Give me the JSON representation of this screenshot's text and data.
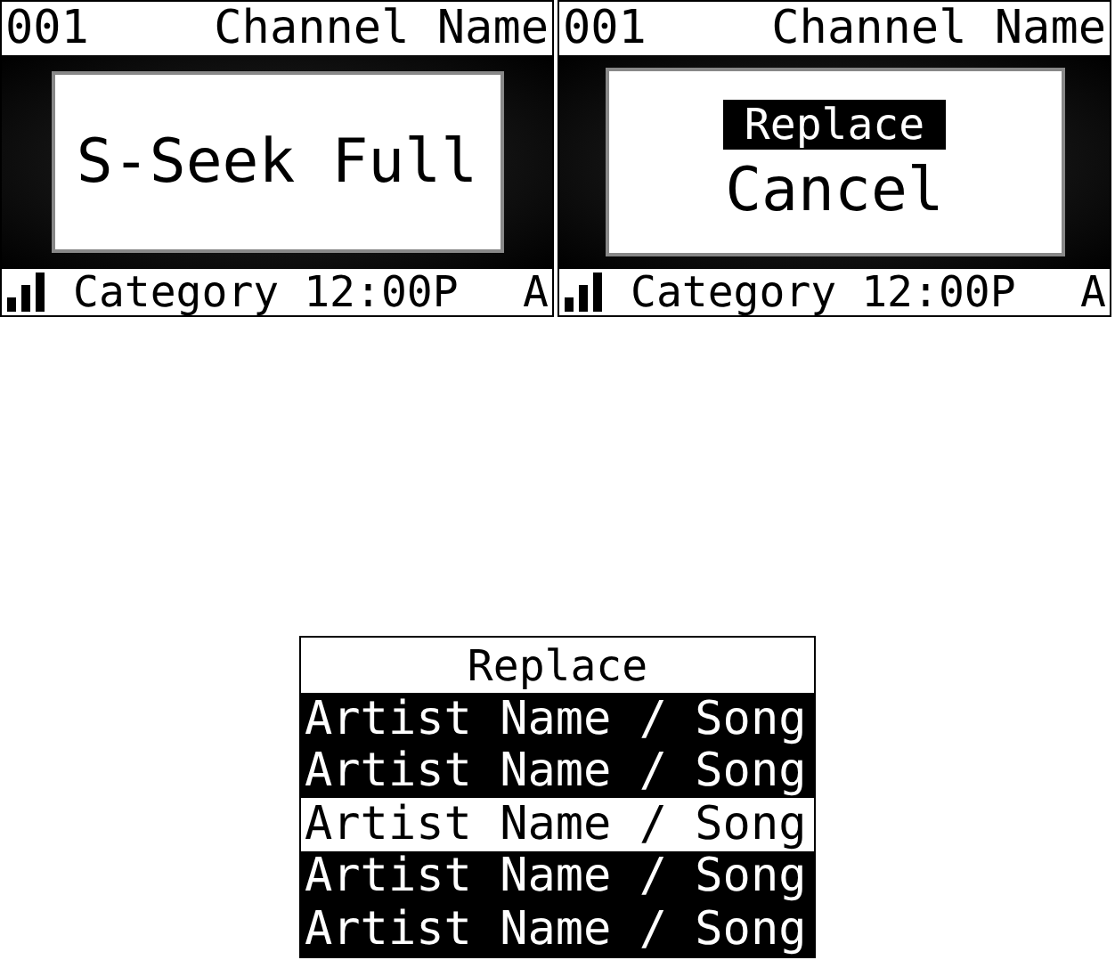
{
  "screens": [
    {
      "header": {
        "channel_number": "001",
        "channel_name": "Channel Name"
      },
      "popup": {
        "kind": "message",
        "text": "S-Seek Full"
      },
      "footer": {
        "category": "Category",
        "time": "12:00P",
        "indicator": "A"
      }
    },
    {
      "header": {
        "channel_number": "001",
        "channel_name": "Channel Name"
      },
      "popup": {
        "kind": "menu",
        "options": [
          {
            "label": "Replace",
            "selected": true
          },
          {
            "label": "Cancel",
            "selected": false
          }
        ]
      },
      "footer": {
        "category": "Category",
        "time": "12:00P",
        "indicator": "A"
      }
    }
  ],
  "replace_list": {
    "title": "Replace",
    "items": [
      {
        "label": "Artist Name / Song",
        "selected": false
      },
      {
        "label": "Artist Name / Song",
        "selected": false
      },
      {
        "label": "Artist Name / Song",
        "selected": true
      },
      {
        "label": "Artist Name / Song",
        "selected": false
      },
      {
        "label": "Artist Name / Song",
        "selected": false
      }
    ]
  }
}
